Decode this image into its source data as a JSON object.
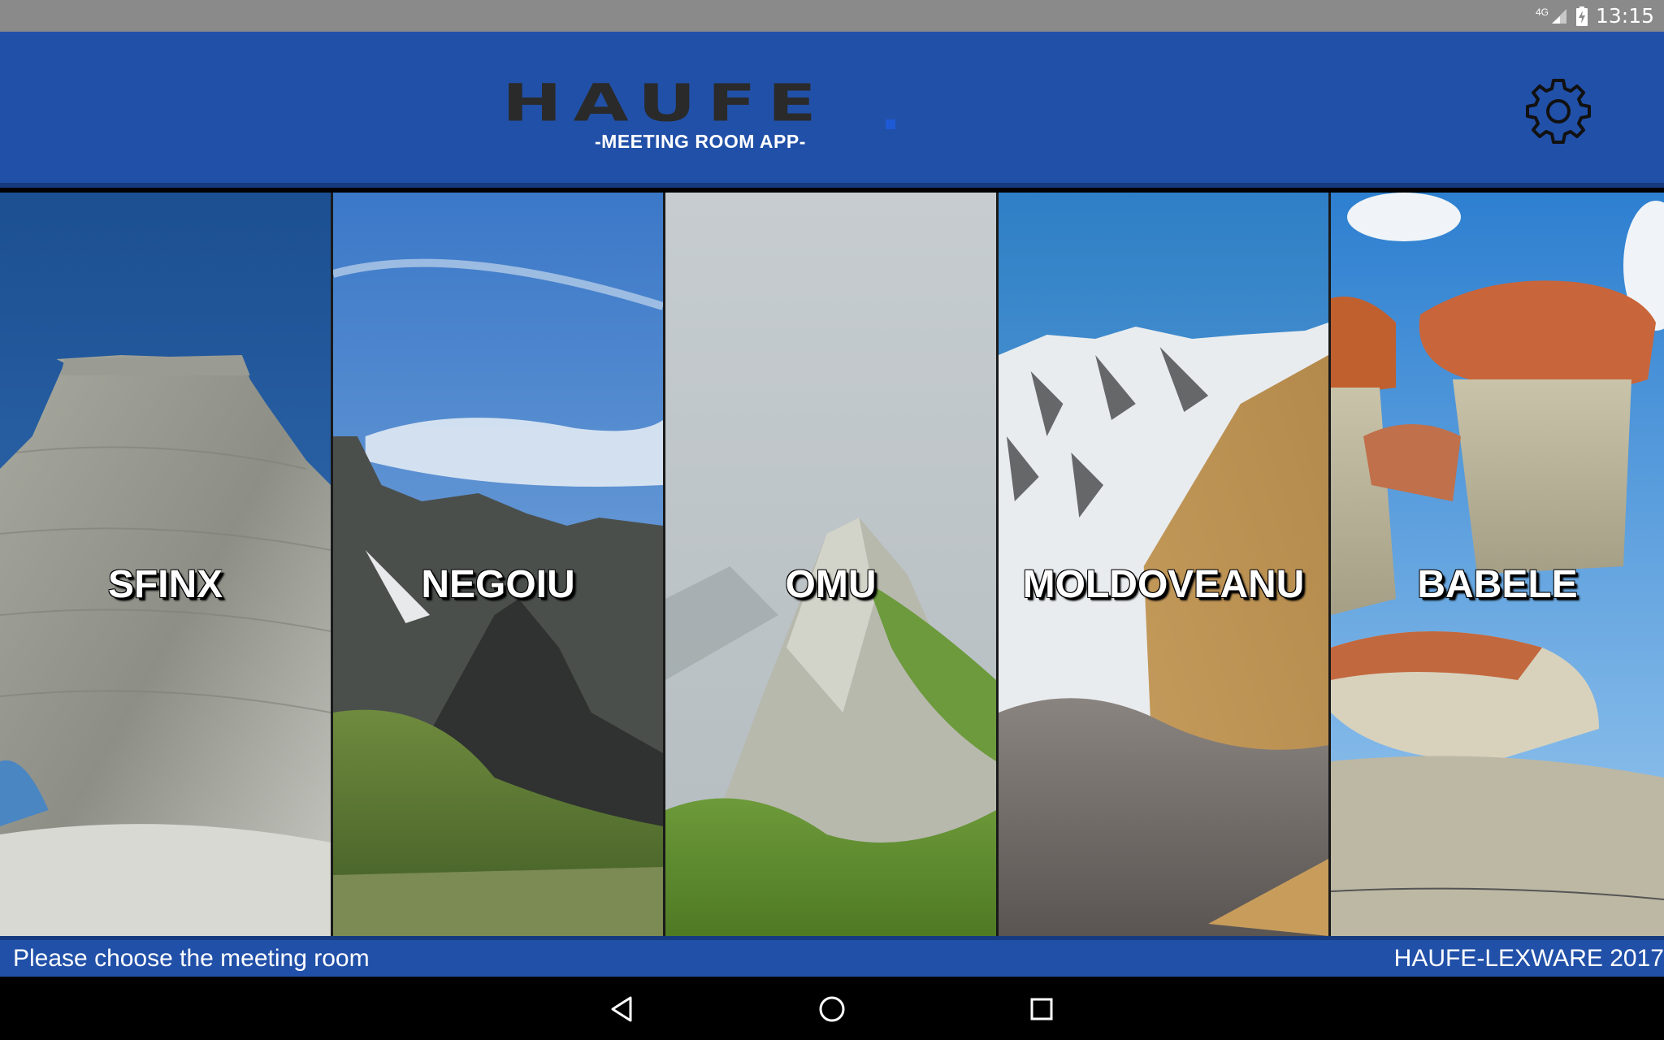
{
  "status_bar": {
    "network": "4G",
    "time": "13:15"
  },
  "header": {
    "logo_text": "HAUFE",
    "subtitle": "-MEETING ROOM APP-",
    "settings_icon": "gear-icon"
  },
  "rooms": [
    {
      "label": "SFINX"
    },
    {
      "label": "NEGOIU"
    },
    {
      "label": "OMU"
    },
    {
      "label": "MOLDOVEANU"
    },
    {
      "label": "BABELE"
    }
  ],
  "footer": {
    "prompt": "Please choose the meeting room",
    "copyright": "HAUFE-LEXWARE 2017"
  },
  "nav": {
    "back_icon": "back-triangle-icon",
    "home_icon": "home-circle-icon",
    "recents_icon": "recents-square-icon"
  },
  "colors": {
    "header_bg": "#2150a8",
    "status_bg": "#8a8a8a"
  }
}
